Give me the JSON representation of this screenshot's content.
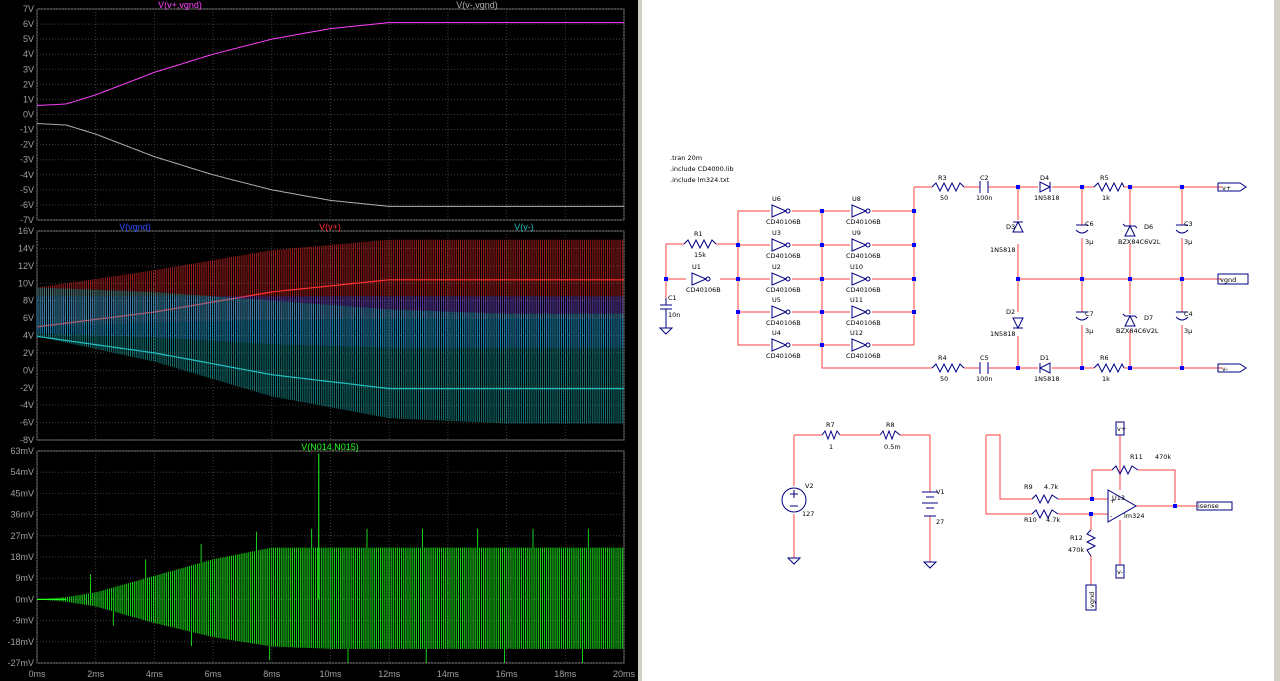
{
  "waveform": {
    "panes": [
      {
        "id": "pane1",
        "traces": [
          {
            "name": "V(v+,vgnd)",
            "color": "#ff40ff"
          },
          {
            "name": "V(v-,vgnd)",
            "color": "#b0b0b0"
          }
        ],
        "y_ticks": [
          "7V",
          "6V",
          "5V",
          "4V",
          "3V",
          "2V",
          "1V",
          "0V",
          "-1V",
          "-2V",
          "-3V",
          "-4V",
          "-5V",
          "-6V",
          "-7V"
        ]
      },
      {
        "id": "pane2",
        "traces": [
          {
            "name": "V(vgnd)",
            "color": "#3050ff"
          },
          {
            "name": "V(v+)",
            "color": "#ff3030"
          },
          {
            "name": "V(v-)",
            "color": "#20c0c0"
          }
        ],
        "y_ticks": [
          "16V",
          "14V",
          "12V",
          "10V",
          "8V",
          "6V",
          "4V",
          "2V",
          "0V",
          "-2V",
          "-4V",
          "-6V",
          "-8V"
        ]
      },
      {
        "id": "pane3",
        "traces": [
          {
            "name": "V(N014,N015)",
            "color": "#20ff20"
          }
        ],
        "y_ticks": [
          "63mV",
          "54mV",
          "45mV",
          "36mV",
          "27mV",
          "18mV",
          "9mV",
          "0mV",
          "-9mV",
          "-18mV",
          "-27mV"
        ]
      }
    ],
    "x_ticks": [
      "0ms",
      "2ms",
      "4ms",
      "6ms",
      "8ms",
      "10ms",
      "12ms",
      "14ms",
      "16ms",
      "18ms",
      "20ms"
    ]
  },
  "chart_data": [
    {
      "type": "line",
      "x_unit": "ms",
      "x_range": [
        0,
        20
      ],
      "ylim": [
        -7,
        7
      ],
      "y_unit": "V",
      "grid": true,
      "series": [
        {
          "name": "V(v+,vgnd)",
          "x": [
            0,
            1,
            2,
            4,
            6,
            8,
            10,
            12,
            14,
            16,
            18,
            20
          ],
          "values": [
            0.6,
            0.7,
            1.3,
            2.8,
            4.0,
            5.0,
            5.7,
            6.1,
            6.1,
            6.1,
            6.1,
            6.1
          ]
        },
        {
          "name": "V(v-,vgnd)",
          "x": [
            0,
            1,
            2,
            4,
            6,
            8,
            10,
            12,
            14,
            16,
            18,
            20
          ],
          "values": [
            -0.6,
            -0.7,
            -1.3,
            -2.8,
            -4.0,
            -5.0,
            -5.7,
            -6.1,
            -6.1,
            -6.1,
            -6.1,
            -6.1
          ]
        }
      ]
    },
    {
      "type": "line",
      "x_unit": "ms",
      "x_range": [
        0,
        20
      ],
      "ylim": [
        -8,
        16
      ],
      "y_unit": "V",
      "grid": true,
      "series": [
        {
          "name": "V(vgnd)",
          "x": [
            0,
            4,
            8,
            12,
            16,
            20
          ],
          "envelope_high": [
            8.5,
            8.5,
            8.5,
            8.5,
            8.5,
            8.5
          ],
          "envelope_low": [
            4.2,
            3.8,
            3.0,
            2.6,
            2.6,
            2.6
          ]
        },
        {
          "name": "V(v+)",
          "x": [
            0,
            4,
            8,
            12,
            16,
            20
          ],
          "envelope_high": [
            9.5,
            11.5,
            13.8,
            15.0,
            15.0,
            15.0
          ],
          "envelope_low": [
            5.0,
            5.5,
            5.8,
            6.0,
            6.0,
            6.0
          ],
          "mean": [
            5.0,
            6.7,
            9.0,
            10.4,
            10.4,
            10.4
          ]
        },
        {
          "name": "V(v-)",
          "x": [
            0,
            4,
            8,
            12,
            16,
            20
          ],
          "envelope_high": [
            9.5,
            9.0,
            8.0,
            7.0,
            6.5,
            6.5
          ],
          "envelope_low": [
            3.9,
            1.0,
            -3.0,
            -5.5,
            -6.1,
            -6.1
          ],
          "mean": [
            3.9,
            2.0,
            -0.5,
            -2.1,
            -2.1,
            -2.1
          ]
        }
      ]
    },
    {
      "type": "line",
      "x_unit": "ms",
      "x_range": [
        0,
        20
      ],
      "ylim": [
        -27,
        63
      ],
      "y_unit": "mV",
      "grid": true,
      "series": [
        {
          "name": "V(N014,N015)",
          "x": [
            0,
            1,
            2,
            4,
            6,
            8,
            10,
            12,
            14,
            16,
            18,
            20
          ],
          "envelope_high": [
            0,
            1,
            3,
            10,
            17,
            22,
            22,
            22,
            22,
            22,
            22,
            22
          ],
          "envelope_low": [
            0,
            -1,
            -3,
            -10,
            -16,
            -20,
            -21,
            -21,
            -21,
            -21,
            -21,
            -21
          ],
          "spike_max": 62
        }
      ]
    }
  ],
  "schematic": {
    "directives": [
      ".tran 20m",
      ".include CD4000.lib",
      ".include lm324.txt"
    ],
    "labels": {
      "r1": "R1",
      "r1v": "15k",
      "c1": "C1",
      "c1v": "10n",
      "u1": "U1",
      "u1v": "CD40106B",
      "u3": "U3",
      "u3v": "CD40106B",
      "u2": "U2",
      "u2v": "CD40106B",
      "u4": "U4",
      "u4v": "CD40106B",
      "u5": "U5",
      "u5v": "CD40106B",
      "u6": "U6",
      "u6v": "CD40106B",
      "u8": "U8",
      "u8v": "CD40106B",
      "u9": "U9",
      "u9v": "CD40106B",
      "u10": "U10",
      "u10v": "CD40106B",
      "u11": "U11",
      "u11v": "CD40106B",
      "u12": "U12",
      "u12v": "CD40106B",
      "r3": "R3",
      "r3v": "50",
      "r4": "R4",
      "r4v": "50",
      "c2": "C2",
      "c2v": "100n",
      "c5": "C5",
      "c5v": "100n",
      "d4": "D4",
      "d4v": "1N5818",
      "d3": "D3",
      "d3v": "1N5818",
      "d2": "D2",
      "d2v": "1N5818",
      "d1": "D1",
      "d1v": "1N5818",
      "r5": "R5",
      "r5v": "1k",
      "r6": "R6",
      "r6v": "1k",
      "c6": "C6",
      "c6v": "3µ",
      "c7": "C7",
      "c7v": "3µ",
      "d6": "D6",
      "d6v": "BZX84C6V2L",
      "d7": "D7",
      "d7v": "BZX84C6V2L",
      "c3": "C3",
      "c3v": "3µ",
      "c4": "C4",
      "c4v": "3µ",
      "vplus": "v+",
      "vgnd": "vgnd",
      "vminus": "v-",
      "r7": "R7",
      "r7v": "1",
      "r8": "R8",
      "r8v": "0.5m",
      "v2": "V2",
      "v2v": "127",
      "v1": "V1",
      "v1v": "27",
      "r11": "R11",
      "r11v": "470k",
      "r9": "R9",
      "r9v": "4.7k",
      "r10": "R10",
      "r10v": "4.7k",
      "u13": "U13",
      "u13v": "lm324",
      "r12": "R12",
      "r12v": "470k",
      "isense": "isense",
      "opamp_vplus": "v+",
      "opamp_vminus": "v-",
      "opamp_vgnd": "vgnd"
    }
  }
}
